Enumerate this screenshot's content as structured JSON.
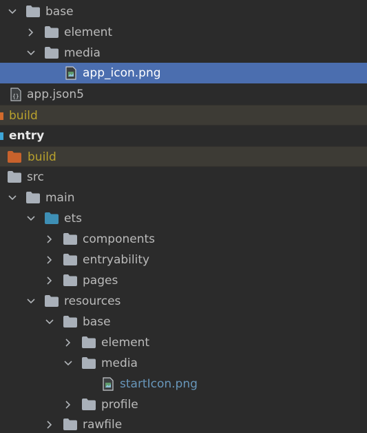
{
  "colors": {
    "background": "#2b2b2b",
    "selection": "#4b6eaf",
    "excluded_row": "#3d3b35",
    "folder_gray": "#a9b0b9",
    "folder_source": "#3e8fb5",
    "folder_excluded": "#c8622c",
    "excluded_text": "#b8a12d",
    "link_text": "#6897bb",
    "module_marker_build": "#d36b2c",
    "module_marker_entry": "#3ea6d8"
  },
  "project_tree": {
    "rows": [
      {
        "label": "base",
        "icon": "folder-icon",
        "arrow": "chevron-down-icon"
      },
      {
        "label": "element",
        "icon": "folder-icon",
        "arrow": "chevron-right-icon"
      },
      {
        "label": "media",
        "icon": "folder-icon",
        "arrow": "chevron-down-icon"
      },
      {
        "label": "app_icon.png",
        "icon": "image-file-icon",
        "selected": true
      },
      {
        "label": "app.json5",
        "icon": "json-file-icon"
      },
      {
        "label": "build",
        "icon": "module-marker",
        "excluded": true
      },
      {
        "label": "entry",
        "icon": "module-marker"
      },
      {
        "label": "build",
        "icon": "excluded-folder-icon",
        "excluded": true
      },
      {
        "label": "src",
        "icon": "folder-icon"
      },
      {
        "label": "main",
        "icon": "folder-icon",
        "arrow": "chevron-down-icon"
      },
      {
        "label": "ets",
        "icon": "source-folder-icon",
        "arrow": "chevron-down-icon"
      },
      {
        "label": "components",
        "icon": "folder-icon",
        "arrow": "chevron-right-icon"
      },
      {
        "label": "entryability",
        "icon": "folder-icon",
        "arrow": "chevron-right-icon"
      },
      {
        "label": "pages",
        "icon": "folder-icon",
        "arrow": "chevron-right-icon"
      },
      {
        "label": "resources",
        "icon": "folder-icon",
        "arrow": "chevron-down-icon"
      },
      {
        "label": "base",
        "icon": "folder-icon",
        "arrow": "chevron-down-icon"
      },
      {
        "label": "element",
        "icon": "folder-icon",
        "arrow": "chevron-right-icon"
      },
      {
        "label": "media",
        "icon": "folder-icon",
        "arrow": "chevron-down-icon"
      },
      {
        "label": "startIcon.png",
        "icon": "image-file-icon"
      },
      {
        "label": "profile",
        "icon": "folder-icon",
        "arrow": "chevron-right-icon"
      },
      {
        "label": "rawfile",
        "icon": "folder-icon",
        "arrow": "chevron-right-icon"
      }
    ]
  }
}
